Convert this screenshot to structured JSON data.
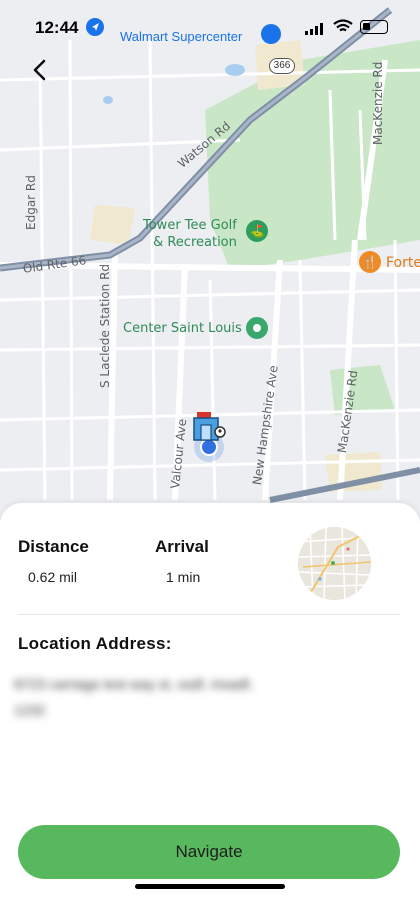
{
  "status_bar": {
    "time": "12:44"
  },
  "map": {
    "labels": {
      "walmart": "Walmart Supercenter",
      "route_366": "366",
      "watson_rd": "Watson Rd",
      "old_rte_66": "Old Rte 66",
      "edgar_rd": "Edgar Rd",
      "tower_tee": "Tower Tee Golf\n& Recreation",
      "forte": "Forte",
      "s_laclede": "S Laclede Station Rd",
      "center_saint_louis": "Center Saint Louis",
      "mackenzie_rd_top": "MacKenzie Rd",
      "mackenzie_rd_bottom": "MacKenzie Rd",
      "new_hampshire": "New Hampshire Ave",
      "valcour_ave": "Valcour Ave"
    }
  },
  "sheet": {
    "distance_label": "Distance",
    "distance_value": "0.62 mil",
    "arrival_label": "Arrival",
    "arrival_value": "1 min",
    "address_title": "Location Address:",
    "address_text": "8723 carriage test way st, ssdf, msadf, 1232",
    "navigate_label": "Navigate"
  },
  "colors": {
    "accent_green": "#58b85e",
    "poi_green": "#2e8b57",
    "link_blue": "#1a73e8"
  }
}
